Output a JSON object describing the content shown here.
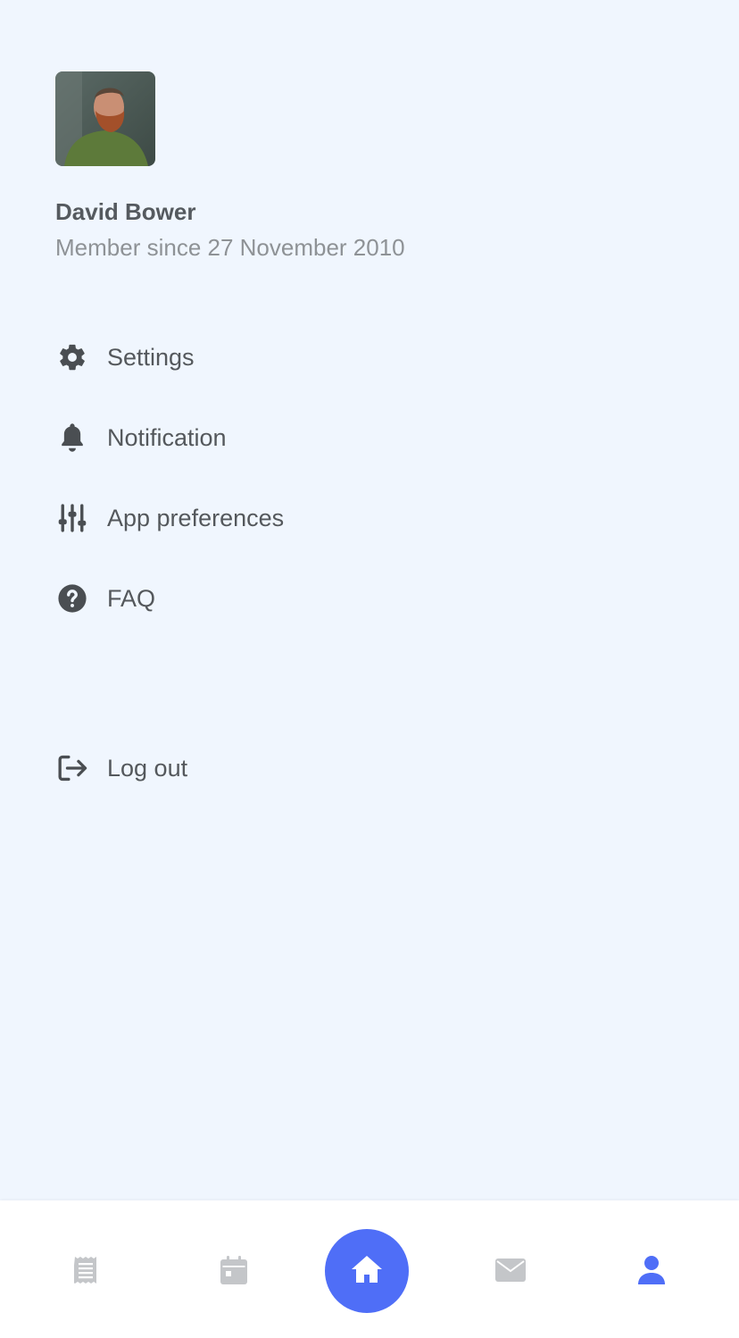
{
  "profile": {
    "name": "David Bower",
    "member_since": "Member since 27 November 2010",
    "avatar_icon": "user-photo"
  },
  "menu": {
    "settings": {
      "label": "Settings",
      "icon": "gear-icon"
    },
    "notification": {
      "label": "Notification",
      "icon": "bell-icon"
    },
    "app_preferences": {
      "label": "App preferences",
      "icon": "sliders-icon"
    },
    "faq": {
      "label": "FAQ",
      "icon": "question-circle-icon"
    },
    "logout": {
      "label": "Log out",
      "icon": "logout-icon"
    }
  },
  "bottom_nav": {
    "items": [
      {
        "icon": "receipt-icon",
        "active": false
      },
      {
        "icon": "calendar-icon",
        "active": false
      },
      {
        "icon": "home-icon",
        "active": false,
        "highlighted": true
      },
      {
        "icon": "envelope-icon",
        "active": false
      },
      {
        "icon": "user-icon",
        "active": true
      }
    ]
  },
  "colors": {
    "background": "#f0f6fe",
    "accent": "#4f6ef7",
    "text_primary": "#555a5f",
    "text_secondary": "#8e9296",
    "icon_inactive": "#c4c6c9",
    "icon_menu": "#4a4e52"
  }
}
